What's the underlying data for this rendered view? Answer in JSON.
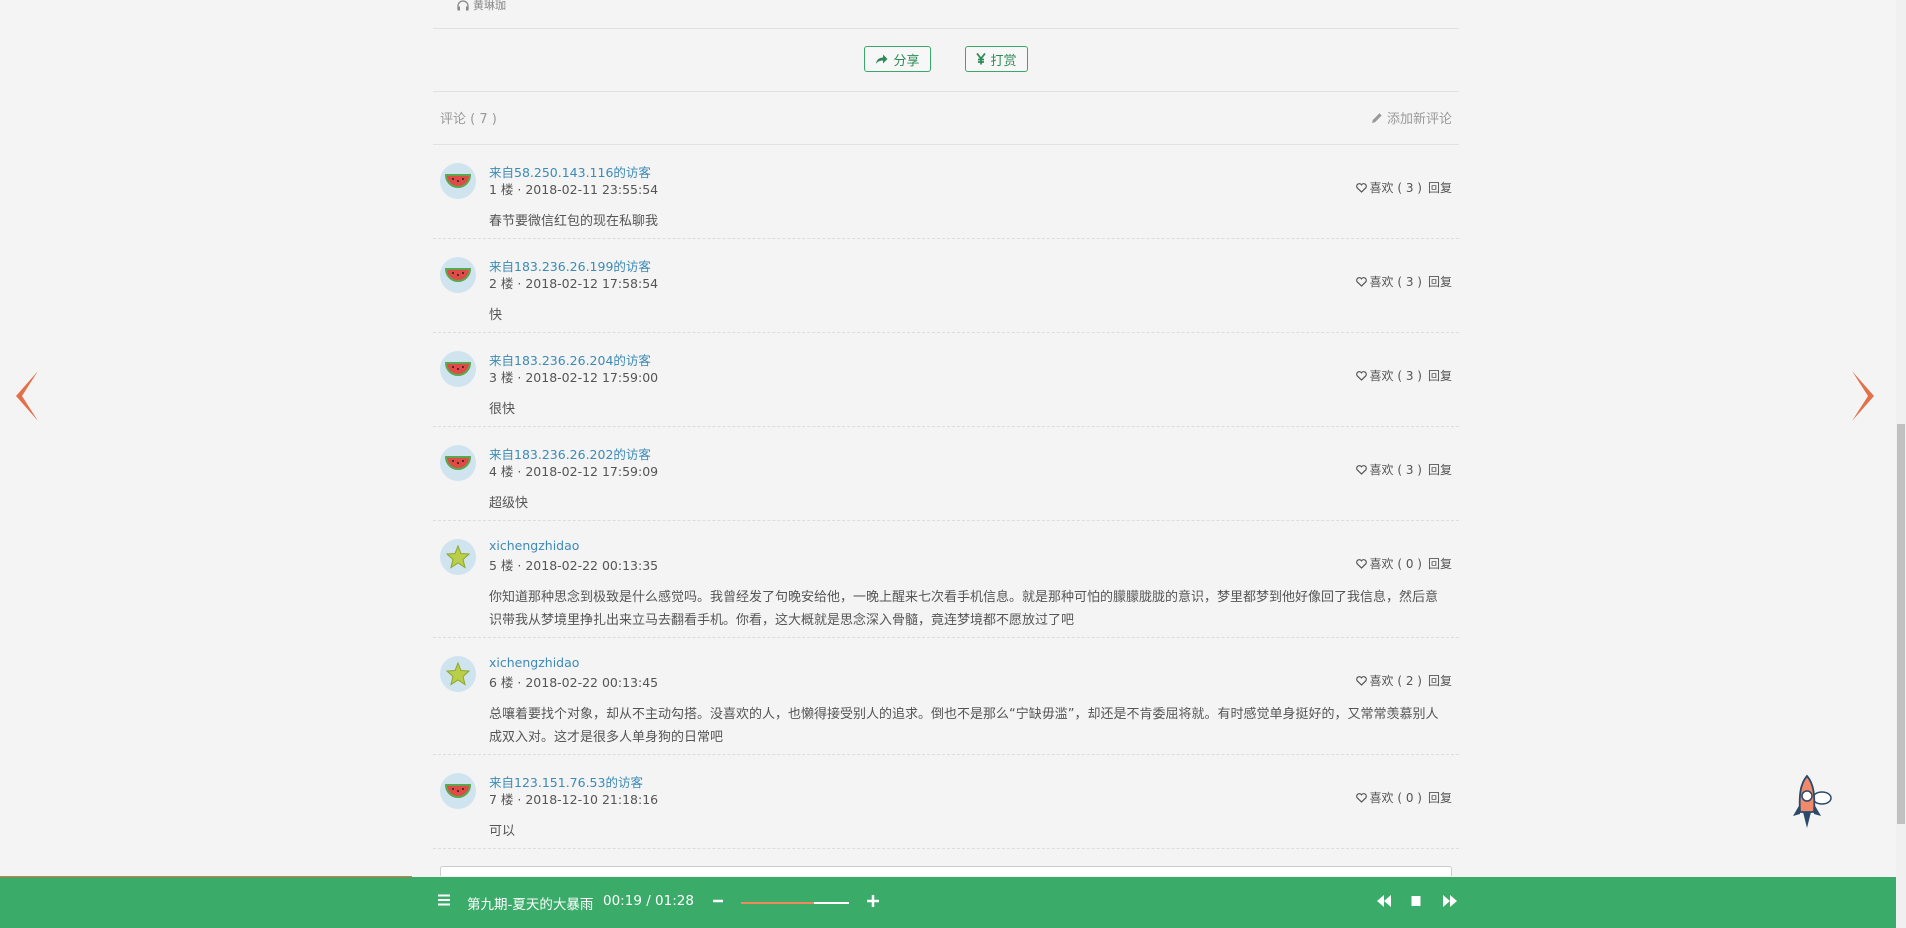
{
  "prev": {
    "label": "黄琳珈"
  },
  "actions": {
    "share": "分享",
    "reward": "打赏"
  },
  "comments_header": {
    "title": "评论 ( 7 )",
    "add": "添加新评论"
  },
  "comments": [
    {
      "name": "来自58.250.143.116的访客",
      "meta": "1 楼 · 2018-02-11 23:55:54",
      "likes": "喜欢 ( 3 )",
      "reply": "回复",
      "text": "春节要微信红包的现在私聊我",
      "avatar": "watermelon-avatar"
    },
    {
      "name": "来自183.236.26.199的访客",
      "meta": "2 楼 · 2018-02-12 17:58:54",
      "likes": "喜欢 ( 3 )",
      "reply": "回复",
      "text": "快",
      "avatar": "watermelon-avatar"
    },
    {
      "name": "来自183.236.26.204的访客",
      "meta": "3 楼 · 2018-02-12 17:59:00",
      "likes": "喜欢 ( 3 )",
      "reply": "回复",
      "text": "很快",
      "avatar": "watermelon-avatar"
    },
    {
      "name": "来自183.236.26.202的访客",
      "meta": "4 楼 · 2018-02-12 17:59:09",
      "likes": "喜欢 ( 3 )",
      "reply": "回复",
      "text": "超级快",
      "avatar": "watermelon-avatar"
    },
    {
      "name": "xichengzhidao",
      "meta": "5 楼 · 2018-02-22 00:13:35",
      "likes": "喜欢 ( 0 )",
      "reply": "回复",
      "text": "你知道那种思念到极致是什么感觉吗。我曾经发了句晚安给他，一晚上醒来七次看手机信息。就是那种可怕的朦朦胧胧的意识，梦里都梦到他好像回了我信息，然后意识带我从梦境里挣扎出来立马去翻看手机。你看，这大概就是思念深入骨髓，竟连梦境都不愿放过了吧",
      "avatar": "starfruit-avatar"
    },
    {
      "name": "xichengzhidao",
      "meta": "6 楼 · 2018-02-22 00:13:45",
      "likes": "喜欢 ( 2 )",
      "reply": "回复",
      "text": "总嚷着要找个对象，却从不主动勾搭。没喜欢的人，也懒得接受别人的追求。倒也不是那么“宁缺毋滥”，却还是不肯委屈将就。有时感觉单身挺好的，又常常羡慕别人成双入对。这才是很多人单身狗的日常吧",
      "avatar": "starfruit-avatar"
    },
    {
      "name": "来自123.151.76.53的访客",
      "meta": "7 楼 · 2018-12-10 21:18:16",
      "likes": "喜欢 ( 0 )",
      "reply": "回复",
      "text": "可以",
      "avatar": "watermelon-avatar"
    }
  ],
  "player": {
    "title": "第九期-夏天的大暴雨",
    "time": "00:19 / 01:28",
    "volume_fraction": 0.68,
    "progress_fraction": 0.216
  },
  "colors": {
    "accent": "#3aab69",
    "arrow": "#e2714a",
    "link": "#3c8ab5"
  },
  "icons": [
    "headphone-icon",
    "share-icon",
    "yen-icon",
    "pencil-icon",
    "heart-icon",
    "prev-arrow-icon",
    "next-arrow-icon",
    "rocket-icon",
    "menu-icon",
    "minus-icon",
    "plus-icon",
    "rewind-icon",
    "stop-icon",
    "fast-forward-icon"
  ]
}
